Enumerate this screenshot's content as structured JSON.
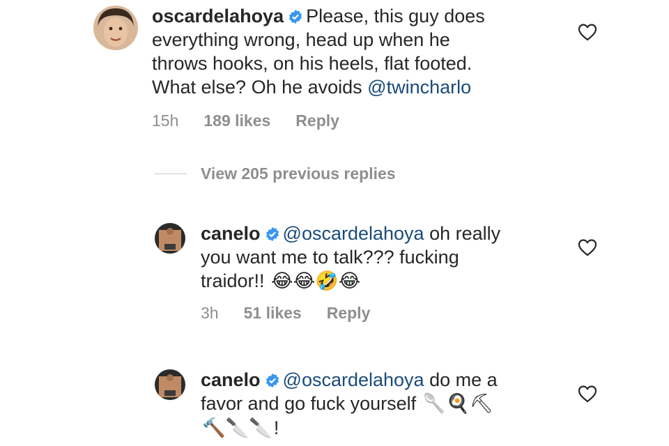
{
  "comments": [
    {
      "username": "oscardelahoya",
      "text_lines": [
        "Please, this guy does",
        "everything wrong, head up when he",
        "throws hooks, on his heels, flat footed.",
        "What else? Oh he avoids "
      ],
      "mention": "@twincharlo",
      "time": "15h",
      "likes": "189 likes",
      "reply_label": "Reply"
    },
    {
      "username": "canelo",
      "mention": "@oscardelahoya",
      "text_lines": [
        " oh really",
        "you want me to talk??? fucking",
        "traidor!! "
      ],
      "emojis": "😂😂🤣😂",
      "time": "3h",
      "likes": "51 likes",
      "reply_label": "Reply"
    },
    {
      "username": "canelo",
      "mention": "@oscardelahoya",
      "text_lines": [
        "  do me a",
        "favor and go fuck yourself "
      ],
      "emojis_line1": "🥄🍳⛏",
      "emojis_line2": "🔨🔪🔪",
      "trailing": "!"
    }
  ],
  "view_replies_label": "View 205 previous replies",
  "icons": {
    "verified": "verified-badge-icon",
    "like": "heart-icon"
  },
  "colors": {
    "verified_blue": "#3897f0",
    "mention": "#1a4b7a",
    "meta_gray": "#8e8e8e"
  }
}
